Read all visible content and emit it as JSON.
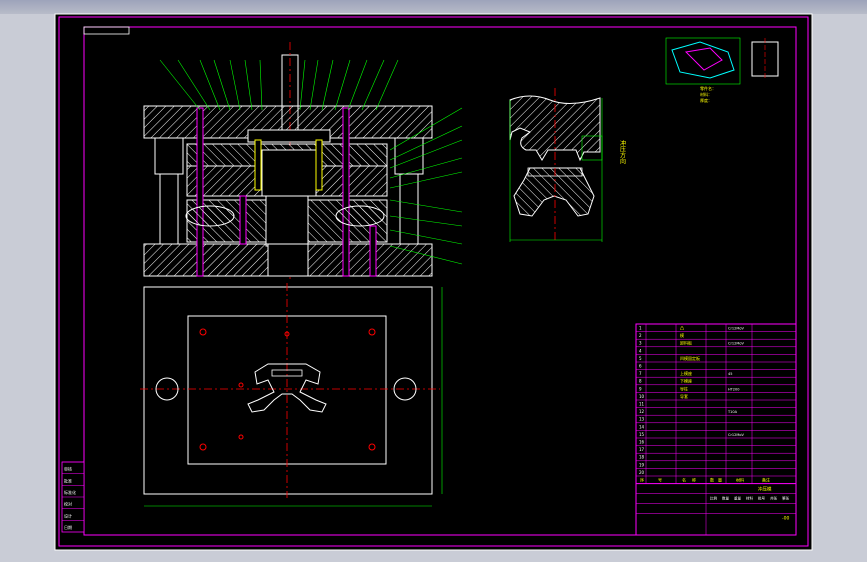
{
  "drawing": {
    "title_block": {
      "rows_left": [
        "1",
        "2",
        "3",
        "4",
        "5",
        "6",
        "7",
        "8",
        "9",
        "10",
        "11",
        "12",
        "13",
        "14",
        "15",
        "16",
        "17",
        "18",
        "19",
        "20"
      ],
      "headers": [
        "序",
        "号",
        "名",
        "称",
        "数",
        "量",
        "材料",
        "备注"
      ],
      "part_names": [
        "凸",
        "模",
        "卸料板",
        "",
        "凹模固定板",
        "",
        "上模座",
        "下模座",
        "导柱",
        "导套",
        "",
        "",
        "",
        "",
        "",
        "",
        "",
        "",
        "",
        ""
      ],
      "materials": [
        "Cr12MoV",
        "",
        "Cr12MoV",
        "",
        "",
        "",
        "45",
        "",
        "HT200",
        "",
        "",
        "T10A",
        "",
        "",
        "Cr12MoV",
        "",
        "",
        "",
        "",
        ""
      ],
      "bottom_cells": [
        "比例",
        "数量",
        "重量",
        "材料",
        "批号",
        "共张",
        "第张"
      ],
      "drawing_id": "冲压模",
      "sheet_no": "-00"
    },
    "left_stamp": [
      "审核",
      "批准",
      "标准化",
      "校对",
      "设计",
      "日期"
    ],
    "inset_note": [
      "零件名：",
      "材料：",
      "厚度："
    ],
    "vertical_note": "冲压方向"
  },
  "colors": {
    "frame_outer": "#ffffff",
    "frame_magenta": "#ff00ff",
    "line_white": "#ffffff",
    "line_green": "#00ff00",
    "line_red": "#ff0000",
    "line_yellow": "#ffff00",
    "line_cyan": "#00ffff"
  }
}
